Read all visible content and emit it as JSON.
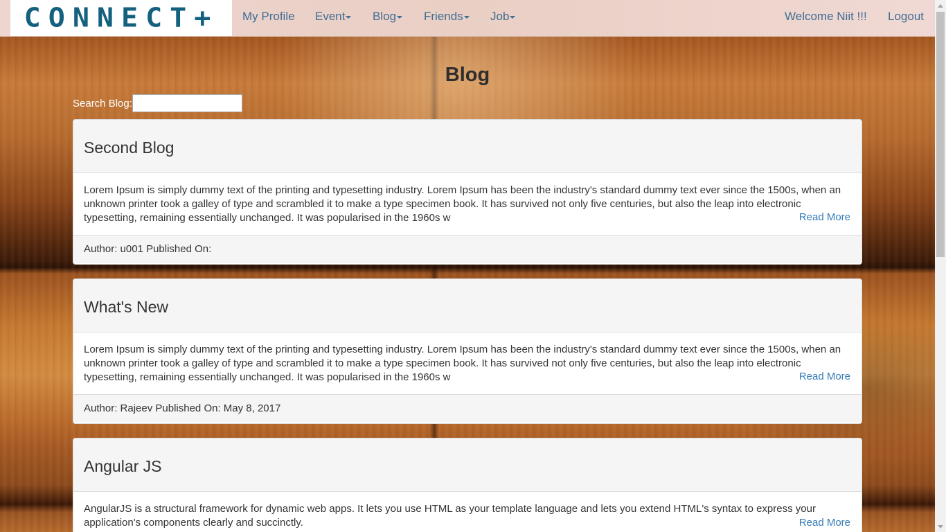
{
  "brand": {
    "logo_text": "CONNECT+"
  },
  "nav": {
    "my_profile": "My Profile",
    "event": "Event",
    "blog": "Blog",
    "friends": "Friends",
    "job": "Job",
    "welcome": "Welcome Niit !!!",
    "logout": "Logout"
  },
  "page": {
    "title": "Blog",
    "search_label": "Search Blog:",
    "search_value": "",
    "search_placeholder": ""
  },
  "blogs": [
    {
      "title": "Second Blog",
      "body": "Lorem Ipsum is simply dummy text of the printing and typesetting industry. Lorem Ipsum has been the industry's standard dummy text ever since the 1500s, when an unknown printer took a galley of type and scrambled it to make a type specimen book. It has survived not only five centuries, but also the leap into electronic typesetting, remaining essentially unchanged. It was popularised in the 1960s w",
      "read_more": "Read More",
      "footer": "Author: u001 Published On:"
    },
    {
      "title": "What's New",
      "body": "Lorem Ipsum is simply dummy text of the printing and typesetting industry. Lorem Ipsum has been the industry's standard dummy text ever since the 1500s, when an unknown printer took a galley of type and scrambled it to make a type specimen book. It has survived not only five centuries, but also the leap into electronic typesetting, remaining essentially unchanged. It was popularised in the 1960s w",
      "read_more": "Read More",
      "footer": "Author: Rajeev Published On: May 8, 2017"
    },
    {
      "title": "Angular JS",
      "body": "AngularJS is a structural framework for dynamic web apps. It lets you use HTML as your template language and lets you extend HTML's syntax to express your application's components clearly and succinctly.",
      "read_more": "Read More",
      "footer": ""
    }
  ],
  "colors": {
    "nav_link": "#3f6d93",
    "logo": "#14607f",
    "link": "#337ab7",
    "panel_heading_bg": "#f5f5f5"
  },
  "icons": [
    "caret-down-icon",
    "scroll-up-arrow-icon",
    "scroll-down-arrow-icon"
  ]
}
